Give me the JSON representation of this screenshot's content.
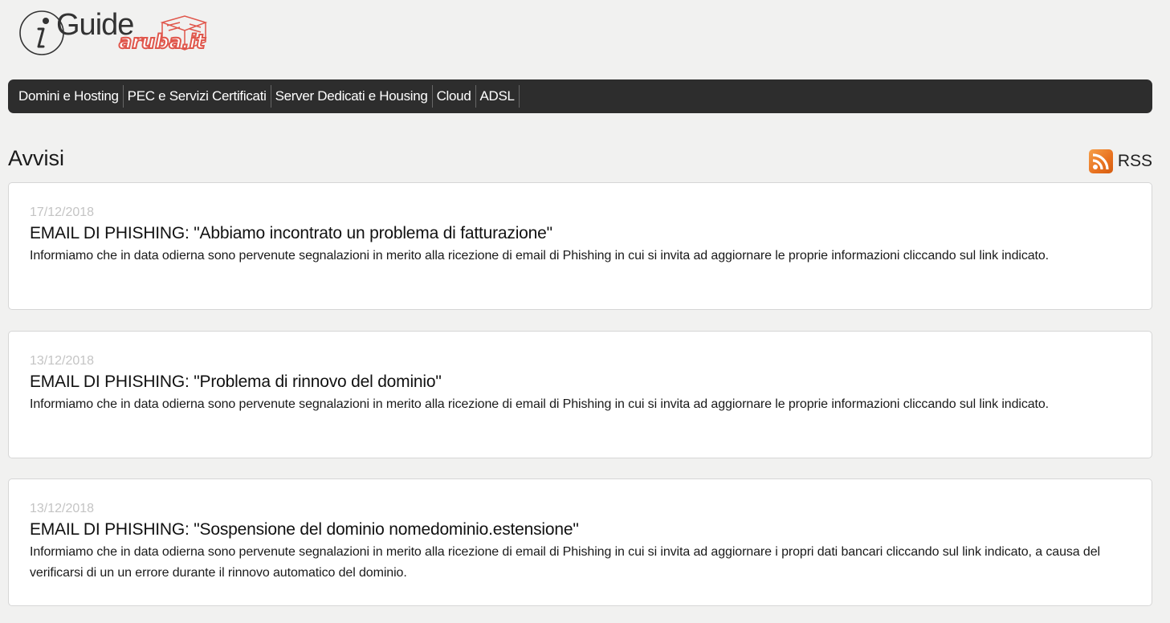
{
  "logo": {
    "guide_text": "Guide",
    "brand_text": "aruba.it"
  },
  "nav": {
    "items": [
      {
        "label": "Domini e Hosting"
      },
      {
        "label": "PEC e Servizi Certificati"
      },
      {
        "label": "Server Dedicati e Housing"
      },
      {
        "label": "Cloud"
      },
      {
        "label": "ADSL"
      }
    ]
  },
  "section": {
    "title": "Avvisi",
    "rss_label": "RSS"
  },
  "notices": [
    {
      "date": "17/12/2018",
      "title": "EMAIL DI PHISHING: \"Abbiamo incontrato un problema di fatturazione\"",
      "text": "Informiamo che in data odierna sono pervenute segnalazioni in merito alla ricezione di email di Phishing in cui si invita ad aggiornare le proprie informazioni cliccando sul link indicato."
    },
    {
      "date": "13/12/2018",
      "title": "EMAIL DI PHISHING: \"Problema di rinnovo del dominio\"",
      "text": "Informiamo che in data odierna sono pervenute segnalazioni in merito alla ricezione di email di Phishing in cui si invita ad aggiornare le proprie informazioni cliccando sul link indicato."
    },
    {
      "date": "13/12/2018",
      "title": "EMAIL DI PHISHING: \"Sospensione del dominio nomedominio.estensione\"",
      "text": "Informiamo che in data odierna sono pervenute segnalazioni in merito alla ricezione di email di Phishing in cui si invita ad aggiornare i propri dati bancari cliccando sul link indicato, a causa del verificarsi di un un errore durante il rinnovo automatico del dominio."
    }
  ],
  "colors": {
    "nav_background": "#2d2d2d",
    "page_background": "#f1f1f0",
    "rss_orange": "#e8711f",
    "brand_red": "#e0564b"
  }
}
